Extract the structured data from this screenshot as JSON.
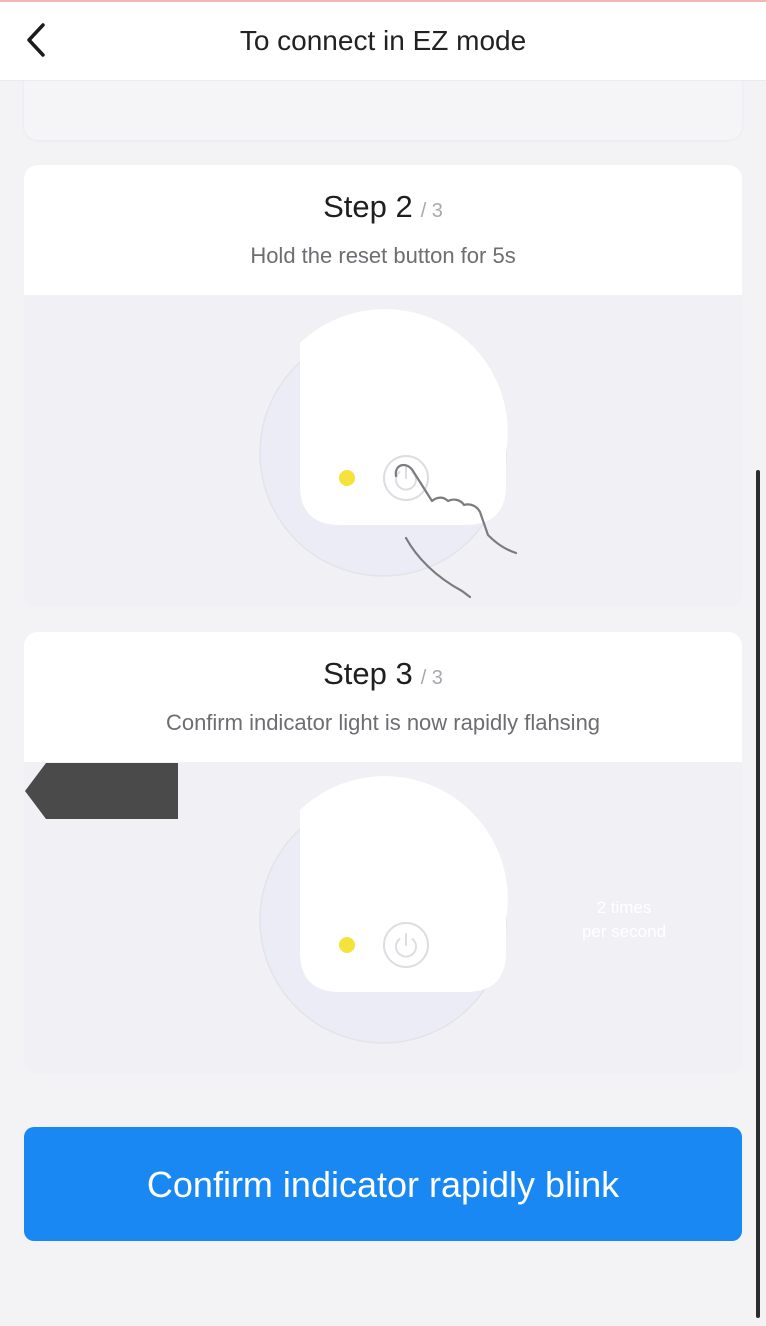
{
  "header": {
    "title": "To connect in EZ mode",
    "back_icon": "chevron-left-icon"
  },
  "steps": [
    {
      "title": "Step 2",
      "total": "/ 3",
      "description": "Hold the reset button for 5s"
    },
    {
      "title": "Step 3",
      "total": "/ 3",
      "description": "Confirm indicator light is now rapidly flahsing",
      "badge": {
        "line1": "2 times",
        "line2": "per second"
      }
    }
  ],
  "confirm_button": {
    "label": "Confirm indicator rapidly blink"
  },
  "colors": {
    "accent_blue": "#1a88f2",
    "indicator_yellow": "#f5e23a",
    "badge_dark": "#4a4a4a",
    "background": "#f3f2f5"
  }
}
